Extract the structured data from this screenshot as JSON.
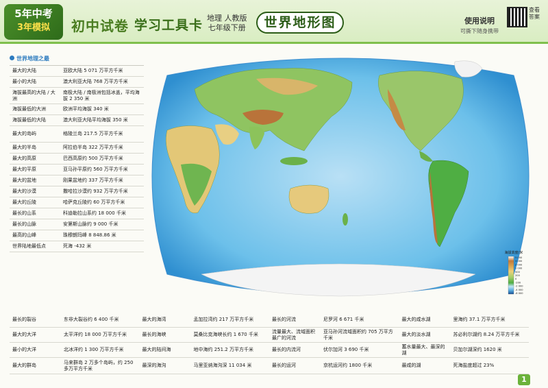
{
  "header": {
    "badge_line1": "5年中考",
    "badge_line2": "3年模拟",
    "series_title": "初中试卷",
    "card_title": "学习工具卡",
    "edition_line1": "地理 人教版",
    "edition_line2": "七年级下册",
    "map_title": "世界地形图",
    "usage_title": "使用说明",
    "usage_sub": "可撕下随身携带",
    "qr_label": "查看答案"
  },
  "section_title": "世界地理之最",
  "facts": [
    {
      "k": "最大的大陆",
      "v": "亚欧大陆 5 071 万平方千米"
    },
    {
      "k": "最小的大陆",
      "v": "澳大利亚大陆 768 万平方千米"
    },
    {
      "k": "海拔最高的大陆 / 大洲",
      "v": "南极大陆 / 南极洲包括冰盖，平均海拔 2 350 米"
    },
    {
      "k": "海拔最低的大洲",
      "v": "欧洲平均海拔 340 米"
    },
    {
      "k": "海拔最低的大陆",
      "v": "澳大利亚大陆平均海拔 350 米"
    },
    {
      "k": "最大的岛屿",
      "v": "格陵兰岛 217.5 万平方千米"
    },
    {
      "k": "最大的半岛",
      "v": "阿拉伯半岛 322 万平方千米"
    },
    {
      "k": "最大的高原",
      "v": "巴西高原约 500 万平方千米"
    },
    {
      "k": "最大的平原",
      "v": "亚马孙平原约 560 万平方千米"
    },
    {
      "k": "最大的盆地",
      "v": "刚果盆地约 337 万平方千米"
    },
    {
      "k": "最大的沙漠",
      "v": "撒哈拉沙漠约 932 万平方千米"
    },
    {
      "k": "最大的丘陵",
      "v": "哈萨克丘陵约 60 万平方千米"
    },
    {
      "k": "最长的山系",
      "v": "科迪勒拉山系约 18 000 千米"
    },
    {
      "k": "最长的山脉",
      "v": "安第斯山脉约 9 000 千米"
    },
    {
      "k": "最高的山峰",
      "v": "珠穆朗玛峰 8 848.86 米"
    },
    {
      "k": "世界陆地最低点",
      "v": "死海 -432 米"
    }
  ],
  "bottom_rows": [
    [
      {
        "k": "最长的裂谷",
        "v": "东非大裂谷约 6 400 千米"
      },
      {
        "k": "最大的海湾",
        "v": "孟加拉湾约 217 万平方千米"
      },
      {
        "k": "最长的河流",
        "v": "尼罗河 6 671 千米"
      },
      {
        "k": "最大的咸水湖",
        "v": "里海约 37.1 万平方千米"
      }
    ],
    [
      {
        "k": "最大的大洋",
        "v": "太平洋约 18 000 万平方千米"
      },
      {
        "k": "最长的海峡",
        "v": "莫桑比克海峡长约 1 670 千米"
      },
      {
        "k": "流量最大、流域面积最广的河流",
        "v": "亚马孙河流域面积约 705 万平方千米"
      },
      {
        "k": "最大的淡水湖",
        "v": "苏必利尔湖约 8.24 万平方千米"
      }
    ],
    [
      {
        "k": "最小的大洋",
        "v": "北冰洋约 1 300 万平方千米"
      },
      {
        "k": "最大的陆间海",
        "v": "地中海约 251.2 万平方千米"
      },
      {
        "k": "最长的内流河",
        "v": "伏尔加河 3 690 千米"
      },
      {
        "k": "蓄水量最大、最深的湖",
        "v": "贝加尔湖深约 1620 米"
      }
    ],
    [
      {
        "k": "最大的群岛",
        "v": "马来群岛 2 万多个岛屿，约 250 多万平方千米"
      },
      {
        "k": "最深的海沟",
        "v": "马里亚纳海沟深 11 034 米"
      },
      {
        "k": "最长的运河",
        "v": "京杭运河约 1800 千米"
      },
      {
        "k": "最咸的湖",
        "v": "死海盐度超过 23%"
      }
    ]
  ],
  "legend": {
    "title": "海拔高度/米",
    "labels": [
      "5 000",
      "3 000",
      "2 000",
      "1 000",
      "500",
      "200",
      "0",
      "-200",
      "-2 000",
      "-4 000",
      "-6 000"
    ]
  },
  "page_number": "1"
}
